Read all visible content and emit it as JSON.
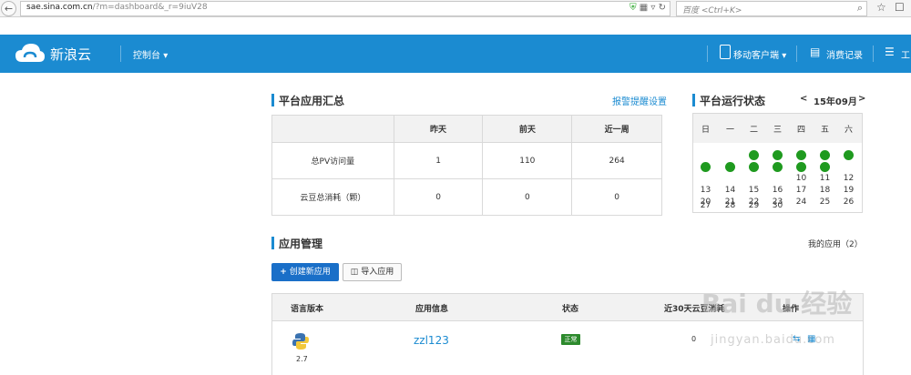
{
  "browser": {
    "url_host": "sae.sina.com.cn",
    "url_path": "/?m=dashboard&_r=9iuV28",
    "search_placeholder": "百度 <Ctrl+K>"
  },
  "header": {
    "brand": "新浪云",
    "console_label": "控制台",
    "mobile_label": "移动客户端",
    "billing_label": "消费记录",
    "more_label": "工"
  },
  "summary": {
    "title": "平台应用汇总",
    "alert_link": "报警提醒设置",
    "columns": [
      "",
      "昨天",
      "前天",
      "近一周"
    ],
    "rows": [
      {
        "label": "总PV访问量",
        "values": [
          "1",
          "110",
          "264"
        ]
      },
      {
        "label": "云豆总消耗（颗）",
        "values": [
          "0",
          "0",
          "0"
        ]
      }
    ]
  },
  "status": {
    "title": "平台运行状态",
    "prev": "<",
    "month": "15年09月",
    "next": ">",
    "weekdays": [
      "日",
      "一",
      "二",
      "三",
      "四",
      "五",
      "六"
    ],
    "dot_days": [
      1,
      2,
      3,
      4,
      5,
      6,
      7,
      8,
      9,
      10,
      11
    ],
    "days": [
      [
        "",
        "",
        "",
        "",
        "",
        "",
        ""
      ],
      [
        "",
        "",
        "",
        "",
        "10",
        "11",
        "12"
      ],
      [
        "13",
        "14",
        "15",
        "16",
        "17",
        "18",
        "19"
      ],
      [
        "20",
        "21",
        "22",
        "23",
        "24",
        "25",
        "26"
      ],
      [
        "27",
        "28",
        "29",
        "30",
        "",
        "",
        ""
      ]
    ]
  },
  "apps": {
    "title": "应用管理",
    "my_apps": "我的应用（2）",
    "create_btn": "创建新应用",
    "import_btn": "导入应用",
    "columns": [
      "语言版本",
      "应用信息",
      "状态",
      "近30天云豆消耗",
      "操作"
    ],
    "row": {
      "version": "2.7",
      "name": "zzl123",
      "status": "正常",
      "cost": "0"
    }
  },
  "colors": {
    "brand_blue": "#1b8bd1",
    "primary_button": "#1a6fc8",
    "status_green": "#2d8a2d",
    "calendar_dot": "#1f9a1f"
  },
  "icons": {
    "logo": "cloud-icon",
    "mobile": "phone-icon",
    "billing": "receipt-icon",
    "create": "plus-icon",
    "import": "import-icon",
    "language": "python-icon"
  }
}
